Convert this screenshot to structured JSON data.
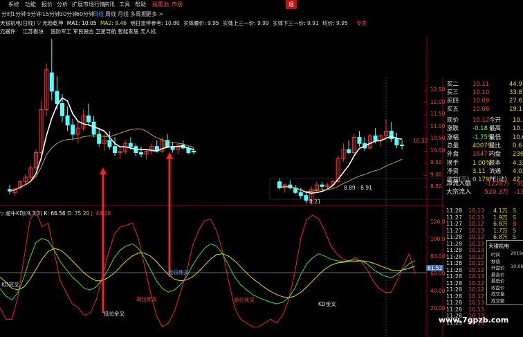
{
  "menu": {
    "items": [
      "系统",
      "功能",
      "报价",
      "分析",
      "扩展市场行情",
      "资讯",
      "工具",
      "帮助"
    ],
    "highlight_items": [
      "股票池",
      "市场"
    ],
    "close_label": "退"
  },
  "periods": {
    "items": [
      "分时",
      "1分钟",
      "5分钟",
      "15分钟",
      "30分钟",
      "60分钟",
      "日线",
      "周线",
      "月线",
      "多周期",
      "更多 >"
    ],
    "active": "日线"
  },
  "info": {
    "stock": "天银机电(日线) ▽ 无趋乾坤",
    "ma1_label": "MA1: 10.05",
    "ma2_label": "MA2: 9.46",
    "ref_label": "明日涨停参考: 10.80",
    "items": [
      "实体腰价: 9.95",
      "实体上三一价: 9.99",
      "实体下三一价: 9.91",
      "均价: 9.95"
    ],
    "tail": "专卖"
  },
  "concepts": {
    "items": [
      "元器件",
      "江苏板块",
      "国防军工 军民融合 卫星导航 智能家居 无人机"
    ]
  },
  "price_axis": {
    "ticks": [
      "12.50",
      "12.00",
      "11.50",
      "11.00",
      "10.50",
      "10.00",
      "9.50",
      "9.00",
      "8.50"
    ]
  },
  "indicator_axis": {
    "ticks": [
      "120.0",
      "100.0",
      "80.00",
      "60.00",
      "40.00",
      "20.00"
    ],
    "marker": "61.52"
  },
  "indicator": {
    "title": "▽ 超牛KDJ(9,3,3)",
    "k": "K: 66.56",
    "d": "D: 75.20",
    "j": "J: 49.28"
  },
  "annotations": {
    "low1": "8.21",
    "range": "8.89 - 8.91",
    "flag1": "10.52",
    "kd_death": "KD死叉",
    "golden1": "低位金叉",
    "death1": "高位死叉",
    "death2": "高位死叉",
    "low_death": "低位死叉",
    "kd_golden": "KD金叉"
  },
  "chart_data": {
    "type": "candlestick",
    "candles": [
      {
        "o": 8.7,
        "h": 8.85,
        "l": 8.55,
        "c": 8.65
      },
      {
        "o": 8.6,
        "h": 8.75,
        "l": 8.5,
        "c": 8.72
      },
      {
        "o": 8.75,
        "h": 9.0,
        "l": 8.7,
        "c": 8.95
      },
      {
        "o": 8.95,
        "h": 9.2,
        "l": 8.85,
        "c": 9.1
      },
      {
        "o": 9.1,
        "h": 9.5,
        "l": 9.0,
        "c": 9.4
      },
      {
        "o": 9.4,
        "h": 10.0,
        "l": 9.35,
        "c": 9.9
      },
      {
        "o": 9.9,
        "h": 11.6,
        "l": 9.8,
        "c": 11.3
      },
      {
        "o": 11.3,
        "h": 12.8,
        "l": 11.1,
        "c": 12.6
      },
      {
        "o": 12.5,
        "h": 13.6,
        "l": 11.6,
        "c": 11.9
      },
      {
        "o": 11.9,
        "h": 12.4,
        "l": 11.3,
        "c": 11.5
      },
      {
        "o": 11.5,
        "h": 11.8,
        "l": 10.9,
        "c": 11.1
      },
      {
        "o": 11.1,
        "h": 11.4,
        "l": 10.6,
        "c": 10.8
      },
      {
        "o": 10.8,
        "h": 11.0,
        "l": 10.3,
        "c": 10.5
      },
      {
        "o": 10.5,
        "h": 10.9,
        "l": 10.2,
        "c": 10.7
      },
      {
        "o": 10.7,
        "h": 11.3,
        "l": 10.6,
        "c": 11.1
      },
      {
        "o": 11.1,
        "h": 11.5,
        "l": 10.8,
        "c": 10.9
      },
      {
        "o": 10.9,
        "h": 11.1,
        "l": 10.4,
        "c": 10.5
      },
      {
        "o": 10.5,
        "h": 10.7,
        "l": 10.1,
        "c": 10.2
      },
      {
        "o": 10.2,
        "h": 10.5,
        "l": 9.95,
        "c": 10.3
      },
      {
        "o": 10.3,
        "h": 10.6,
        "l": 10.0,
        "c": 10.1
      },
      {
        "o": 10.1,
        "h": 10.4,
        "l": 9.8,
        "c": 9.9
      },
      {
        "o": 9.9,
        "h": 10.1,
        "l": 9.7,
        "c": 9.95
      },
      {
        "o": 9.95,
        "h": 10.3,
        "l": 9.85,
        "c": 10.2
      },
      {
        "o": 10.2,
        "h": 10.4,
        "l": 10.0,
        "c": 10.1
      },
      {
        "o": 10.1,
        "h": 10.2,
        "l": 9.8,
        "c": 9.9
      },
      {
        "o": 9.9,
        "h": 10.1,
        "l": 9.75,
        "c": 9.85
      },
      {
        "o": 9.85,
        "h": 10.0,
        "l": 9.7,
        "c": 9.95
      },
      {
        "o": 9.95,
        "h": 10.2,
        "l": 9.85,
        "c": 10.1
      },
      {
        "o": 10.1,
        "h": 10.3,
        "l": 9.9,
        "c": 9.95
      },
      {
        "o": 9.95,
        "h": 10.4,
        "l": 9.9,
        "c": 10.3
      },
      {
        "o": 10.3,
        "h": 10.5,
        "l": 10.05,
        "c": 10.1
      },
      {
        "o": 10.1,
        "h": 10.25,
        "l": 9.9,
        "c": 10.0
      },
      {
        "o": 10.0,
        "h": 10.2,
        "l": 9.85,
        "c": 10.15
      },
      {
        "o": 10.15,
        "h": 10.3,
        "l": 10.0,
        "c": 10.05
      },
      {
        "o": 10.05,
        "h": 10.1,
        "l": 9.85,
        "c": 9.9
      },
      {
        "o": 9.95,
        "h": 10.05,
        "l": 9.85,
        "c": 9.92
      }
    ],
    "candles2": [
      {
        "o": 8.95,
        "h": 9.05,
        "l": 8.7,
        "c": 8.75
      },
      {
        "o": 8.75,
        "h": 8.9,
        "l": 8.6,
        "c": 8.85
      },
      {
        "o": 8.85,
        "h": 9.0,
        "l": 8.7,
        "c": 8.75
      },
      {
        "o": 8.75,
        "h": 8.85,
        "l": 8.55,
        "c": 8.6
      },
      {
        "o": 8.6,
        "h": 8.75,
        "l": 8.4,
        "c": 8.5
      },
      {
        "o": 8.5,
        "h": 8.6,
        "l": 8.25,
        "c": 8.35
      },
      {
        "o": 8.35,
        "h": 8.8,
        "l": 8.21,
        "c": 8.7
      },
      {
        "o": 8.7,
        "h": 8.95,
        "l": 8.6,
        "c": 8.85
      },
      {
        "o": 8.85,
        "h": 8.95,
        "l": 8.7,
        "c": 8.8
      },
      {
        "o": 8.8,
        "h": 8.92,
        "l": 8.7,
        "c": 8.85
      },
      {
        "o": 8.85,
        "h": 9.0,
        "l": 8.75,
        "c": 8.95
      },
      {
        "o": 8.95,
        "h": 9.8,
        "l": 8.9,
        "c": 9.7
      },
      {
        "o": 9.7,
        "h": 10.2,
        "l": 9.6,
        "c": 10.0
      },
      {
        "o": 10.0,
        "h": 10.3,
        "l": 9.85,
        "c": 9.9
      },
      {
        "o": 9.9,
        "h": 10.5,
        "l": 9.8,
        "c": 10.4
      },
      {
        "o": 10.4,
        "h": 10.6,
        "l": 10.1,
        "c": 10.2
      },
      {
        "o": 10.2,
        "h": 10.4,
        "l": 9.95,
        "c": 10.05
      },
      {
        "o": 10.05,
        "h": 10.5,
        "l": 10.0,
        "c": 10.45
      },
      {
        "o": 10.45,
        "h": 10.7,
        "l": 10.2,
        "c": 10.3
      },
      {
        "o": 10.3,
        "h": 10.5,
        "l": 10.1,
        "c": 10.45
      },
      {
        "o": 10.45,
        "h": 11.0,
        "l": 10.3,
        "c": 10.6
      },
      {
        "o": 10.6,
        "h": 10.9,
        "l": 10.25,
        "c": 10.35
      },
      {
        "o": 10.35,
        "h": 10.55,
        "l": 10.05,
        "c": 10.15
      },
      {
        "o": 10.15,
        "h": 10.3,
        "l": 10.0,
        "c": 10.13
      }
    ],
    "ylim": [
      8.2,
      13.7
    ],
    "kdj": {
      "k": [
        30,
        20,
        15,
        25,
        45,
        70,
        90,
        95,
        92,
        80,
        65,
        55,
        45,
        38,
        30,
        28,
        32,
        42,
        55,
        70,
        80,
        85,
        88,
        82,
        70,
        55,
        40,
        30,
        25,
        28,
        35,
        45,
        60,
        72,
        82,
        88,
        85,
        75,
        60,
        45,
        35,
        28,
        22,
        18,
        15,
        12,
        10,
        12,
        18,
        30,
        48,
        62,
        70,
        75,
        72,
        68,
        66,
        65,
        66,
        67,
        66,
        62,
        55,
        50,
        46,
        44,
        48,
        55,
        62,
        66
      ],
      "d": [
        45,
        38,
        30,
        28,
        32,
        42,
        55,
        68,
        78,
        82,
        80,
        74,
        66,
        58,
        50,
        44,
        40,
        40,
        44,
        50,
        58,
        66,
        72,
        76,
        76,
        72,
        65,
        56,
        48,
        42,
        40,
        41,
        45,
        52,
        60,
        68,
        74,
        75,
        72,
        66,
        58,
        50,
        43,
        37,
        31,
        26,
        22,
        19,
        18,
        20,
        25,
        32,
        40,
        48,
        55,
        60,
        63,
        64,
        65,
        65,
        66,
        65,
        63,
        60,
        57,
        54,
        53,
        54,
        56,
        59
      ],
      "j": [
        5,
        -10,
        -10,
        20,
        70,
        120,
        130,
        110,
        115,
        78,
        40,
        25,
        10,
        5,
        -5,
        -2,
        15,
        45,
        75,
        100,
        110,
        112,
        115,
        95,
        60,
        25,
        -5,
        -20,
        -15,
        0,
        25,
        50,
        85,
        105,
        118,
        120,
        105,
        78,
        40,
        5,
        -10,
        -15,
        -20,
        -20,
        -15,
        -10,
        -15,
        -5,
        15,
        50,
        95,
        120,
        125,
        120,
        105,
        85,
        75,
        68,
        66,
        70,
        65,
        55,
        40,
        30,
        25,
        25,
        40,
        58,
        75,
        49
      ]
    }
  },
  "quote": {
    "rows": [
      {
        "label": "买二",
        "price": "10.11",
        "vol": "44.97"
      },
      {
        "label": "买三",
        "price": "10.10",
        "vol": "33.87"
      },
      {
        "label": "买四",
        "price": "10.09",
        "vol": "27.67"
      },
      {
        "label": "买五",
        "price": "10.08",
        "vol": "19.1"
      }
    ],
    "stats": [
      {
        "l1": "现价",
        "v1": "10.12",
        "l2": "今开",
        "v2": "10.1"
      },
      {
        "l1": "涨跌",
        "v1": "-0.18",
        "l2": "最高",
        "v2": "10.1"
      },
      {
        "l1": "涨幅",
        "v1": "-1.75%",
        "l2": "最低",
        "v2": "10.0"
      },
      {
        "l1": "总量",
        "v1": "40079",
        "l2": "量比",
        "v2": "0.6"
      },
      {
        "l1": "外盘",
        "v1": "16477",
        "l2": "内盘",
        "v2": "2360"
      },
      {
        "l1": "换手",
        "v1": "1.00%",
        "l2": "股本",
        "v2": "4.32"
      },
      {
        "l1": "净资",
        "v1": "3.11",
        "l2": "流通",
        "v2": "4.01"
      },
      {
        "l1": "收益(三)",
        "v1": "0.179",
        "l2": "PE(动)",
        "v2": "42."
      }
    ],
    "flow": [
      {
        "label": "净流入额",
        "v1": "-1228万",
        "v2": "-30"
      },
      {
        "label": "大宗流入",
        "v1": "-520.3万",
        "v2": "-13"
      }
    ]
  },
  "ticks": [
    {
      "t": "11:28",
      "p": "10.13",
      "v": "4.1万",
      "f": "S"
    },
    {
      "t": "11:27",
      "p": "10.13",
      "v": "1.9万",
      "f": "S"
    },
    {
      "t": "11:27",
      "p": "10.12",
      "v": "6.8万",
      "f": "B"
    },
    {
      "t": "11:27",
      "p": "10.13",
      "v": "1.7万",
      "f": "S"
    },
    {
      "t": "11:28",
      "p": "10.12",
      "v": "6.8万",
      "f": "S"
    },
    {
      "t": "11:28",
      "p": "10.13",
      "v": "4.7万",
      "f": "S"
    },
    {
      "t": "11:28",
      "p": "10.13",
      "v": "",
      "f": ""
    },
    {
      "t": "11:28",
      "p": "10.12",
      "v": "",
      "f": ""
    },
    {
      "t": "11:28",
      "p": "10.12",
      "v": "",
      "f": ""
    },
    {
      "t": "11:28",
      "p": "10.12",
      "v": "",
      "f": ""
    },
    {
      "t": "11:28",
      "p": "10.13",
      "v": "",
      "f": ""
    },
    {
      "t": "11:28",
      "p": "10.12",
      "v": "",
      "f": ""
    },
    {
      "t": "11:28",
      "p": "10.12",
      "v": "",
      "f": ""
    },
    {
      "t": "11:28",
      "p": "10.12",
      "v": "",
      "f": ""
    },
    {
      "t": "11:28",
      "p": "10.13",
      "v": "",
      "f": ""
    },
    {
      "t": "11:28",
      "p": "10.13",
      "v": "",
      "f": ""
    },
    {
      "t": "11:28",
      "p": "10.13",
      "v": "",
      "f": ""
    },
    {
      "t": "11:29",
      "p": "10.13",
      "v": "",
      "f": ""
    }
  ],
  "popup": {
    "title": "天银机电",
    "rows": [
      "时间",
      "数值",
      "开盘价",
      "最高价",
      "最低价",
      "收盘价",
      "成交量",
      "成交额"
    ],
    "values": [
      "2019/",
      "",
      "10.06",
      "",
      "",
      "",
      "",
      ""
    ]
  },
  "colors": {
    "up": "#ff3232",
    "down": "#54ffff",
    "yellow": "#e8e000",
    "ma_white": "#ffffff",
    "ma_gold": "#c8a030"
  },
  "watermark": "www.7gpzb.com"
}
